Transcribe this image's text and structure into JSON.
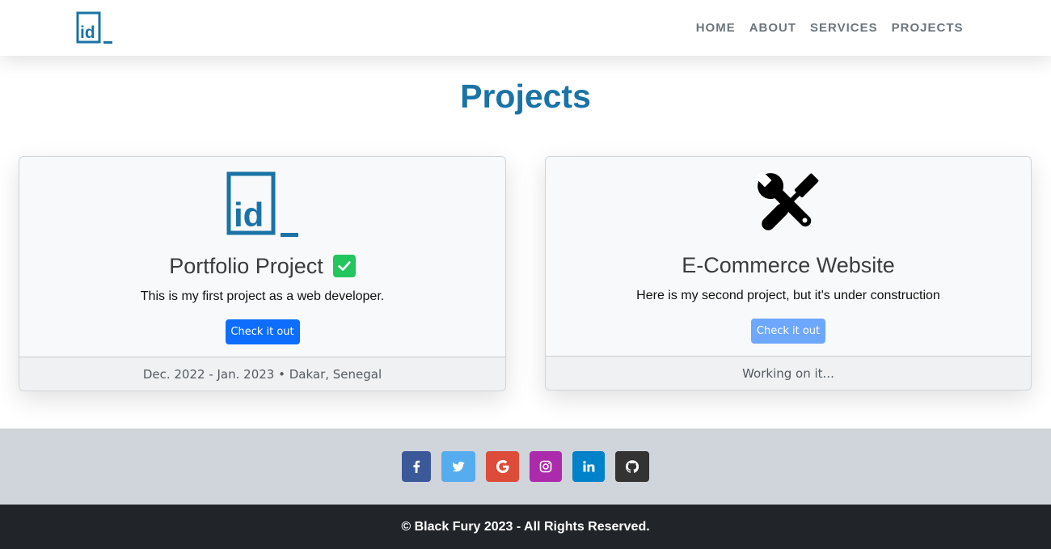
{
  "nav": {
    "logo_icon": "id-logo-icon",
    "links": [
      "HOME",
      "ABOUT",
      "SERVICES",
      "PROJECTS"
    ]
  },
  "section": {
    "title": "Projects"
  },
  "projects": [
    {
      "icon": "id-logo-icon",
      "title": "Portfolio Project",
      "badge_icon": "check-icon",
      "description": "This is my first project as a web developer.",
      "button": "Check it out",
      "footer": "Dec. 2022 - Jan. 2023 • Dakar, Senegal"
    },
    {
      "icon": "tools-icon",
      "title": "E-Commerce Website",
      "description": "Here is my second project, but it's under construction",
      "button": "Check it out",
      "footer": "Working on it..."
    }
  ],
  "social": [
    {
      "icon": "facebook-icon",
      "color": "#3b5998"
    },
    {
      "icon": "twitter-icon",
      "color": "#55acee"
    },
    {
      "icon": "google-icon",
      "color": "#dd4b39"
    },
    {
      "icon": "instagram-icon",
      "color": "#ac2bac"
    },
    {
      "icon": "linkedin-icon",
      "color": "#0082ca"
    },
    {
      "icon": "github-icon",
      "color": "#333333"
    }
  ],
  "footer": {
    "copyright": "© Black Fury 2023 - All Rights Reserved."
  },
  "colors": {
    "brand": "#1a73a6",
    "primary": "#0d6efd",
    "primary_disabled": "#6ea8fe",
    "footer_bg": "#212529",
    "social_band": "#d0d4db"
  }
}
